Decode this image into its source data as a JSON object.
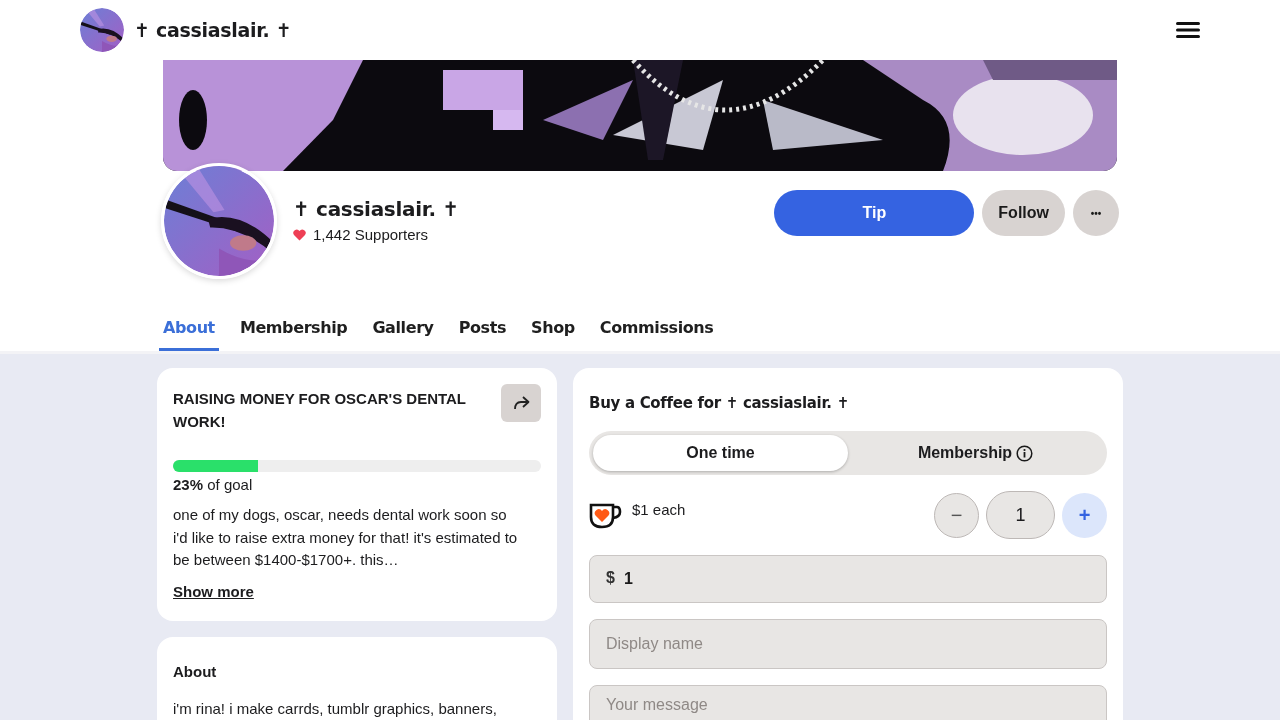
{
  "header": {
    "title": "✝ cassiaslair. ✝"
  },
  "profile": {
    "name": "✝ cassiaslair. ✝",
    "supporters": "1,442 Supporters"
  },
  "actions": [
    {
      "kind": "primary",
      "label": "Tip"
    },
    {
      "kind": "secondary",
      "label": "Follow"
    },
    {
      "kind": "more",
      "label": "•••"
    }
  ],
  "tabs": [
    {
      "label": "About",
      "selected": true
    },
    {
      "label": "Membership",
      "selected": false
    },
    {
      "label": "Gallery",
      "selected": false
    },
    {
      "label": "Posts",
      "selected": false
    },
    {
      "label": "Shop",
      "selected": false
    },
    {
      "label": "Commissions",
      "selected": false
    }
  ],
  "goal": {
    "title": "RAISING MONEY FOR OSCAR'S DENTAL WORK!",
    "level": 0.23,
    "progress_text": "**23%** of goal",
    "description": "one of my dogs, oscar, needs dental work soon so i'd like to raise extra money for that! it's estimated to be between $1400-$1700+. this…",
    "show_more": "Show more"
  },
  "about": {
    "title": "About",
    "text": "i'm rina! i make carrds, tumblr graphics, banners,"
  },
  "coffee": {
    "title": "Buy a Coffee for ✝ cassiaslair. ✝",
    "modes": [
      {
        "label": "One time",
        "selected": true,
        "info": false
      },
      {
        "label": "Membership",
        "selected": false,
        "info": true
      }
    ],
    "price": "$1 each",
    "minus": "−",
    "quantity": "1",
    "plus": "+",
    "amount": {
      "currency": "$",
      "value": "1"
    },
    "name_placeholder": "Display name",
    "message_placeholder": "Your message"
  }
}
